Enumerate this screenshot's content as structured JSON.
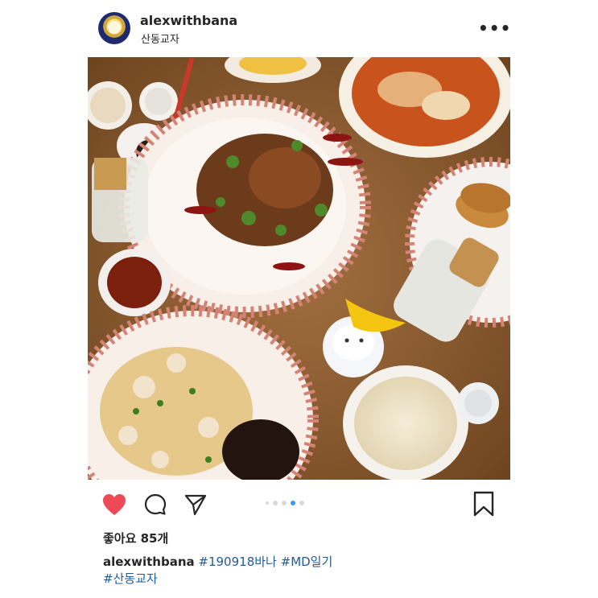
{
  "post": {
    "username": "alexwithbana",
    "location": "산동교자",
    "more_label": "•••"
  },
  "image": {
    "description_icon": "food-photo"
  },
  "actions": {
    "like_icon": "heart-icon",
    "comment_icon": "comment-icon",
    "share_icon": "share-icon",
    "bookmark_icon": "bookmark-icon",
    "carousel_index": 3,
    "carousel_total": 4
  },
  "likes": {
    "label": "좋아요 85개"
  },
  "caption": {
    "username": "alexwithbana",
    "tag1": "#190918바나",
    "tag2": "#MD일기",
    "tag3": "#산동교자"
  },
  "colors": {
    "heart": "#ed4956",
    "carousel_active": "#3897f0",
    "hashtag": "#1f5a9a"
  }
}
